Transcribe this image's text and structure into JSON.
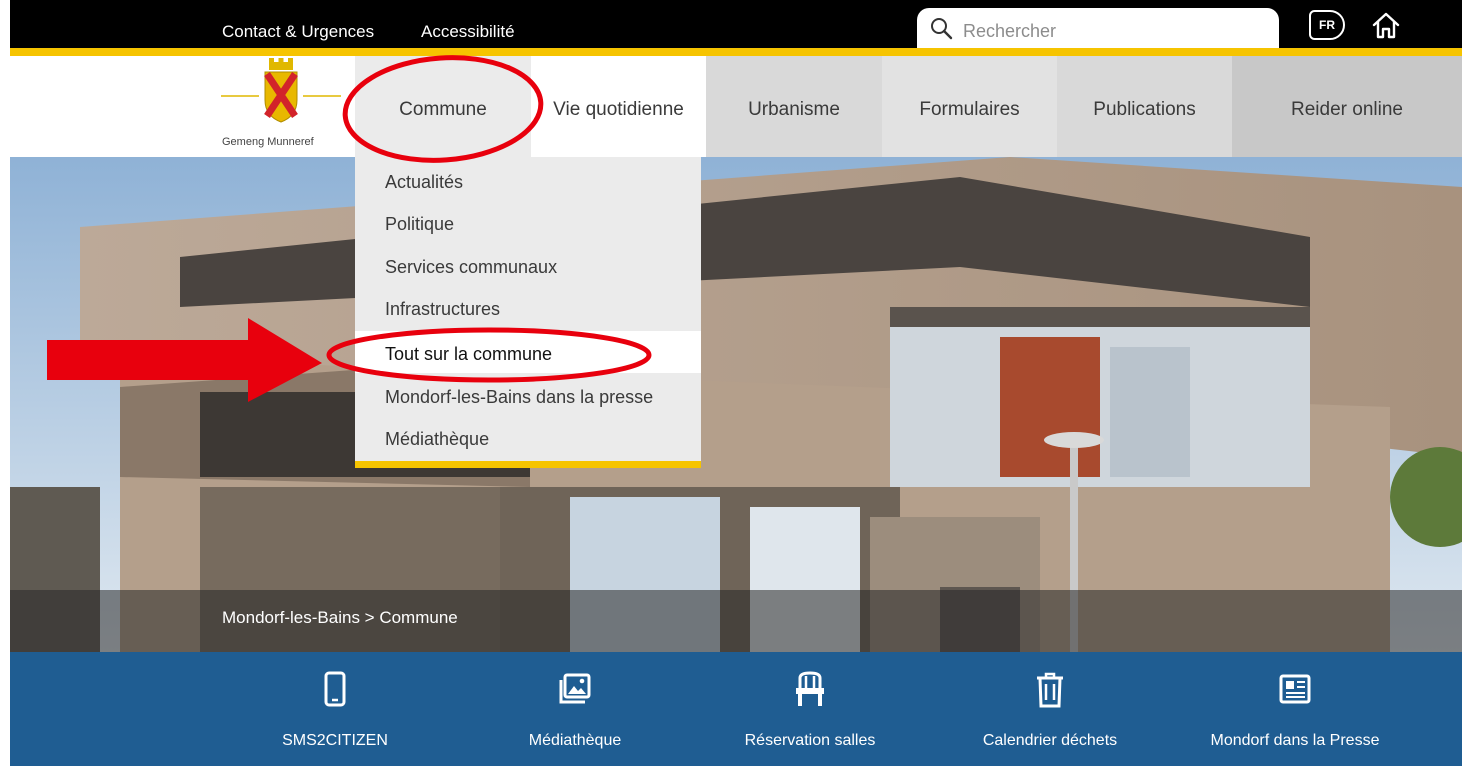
{
  "topbar": {
    "contact_label": "Contact & Urgences",
    "accessibility_label": "Accessibilité",
    "search_placeholder": "Rechercher",
    "language": "FR"
  },
  "logo": {
    "text": "Gemeng Munneref"
  },
  "nav": {
    "items": [
      {
        "label": "Commune"
      },
      {
        "label": "Vie quotidienne"
      },
      {
        "label": "Urbanisme"
      },
      {
        "label": "Formulaires"
      },
      {
        "label": "Publications"
      },
      {
        "label": "Reider online"
      }
    ]
  },
  "dropdown": {
    "items": [
      {
        "label": "Actualités"
      },
      {
        "label": "Politique"
      },
      {
        "label": "Services communaux"
      },
      {
        "label": "Infrastructures"
      },
      {
        "label": "Tout sur la commune"
      },
      {
        "label": "Mondorf-les-Bains dans la presse"
      },
      {
        "label": "Médiathèque"
      }
    ]
  },
  "breadcrumb": {
    "text": "Mondorf-les-Bains > Commune"
  },
  "quicklinks": {
    "items": [
      {
        "label": "SMS2CITIZEN",
        "icon": "phone-icon"
      },
      {
        "label": "Médiathèque",
        "icon": "image-gallery-icon"
      },
      {
        "label": "Réservation salles",
        "icon": "chair-icon"
      },
      {
        "label": "Calendrier déchets",
        "icon": "trash-icon"
      },
      {
        "label": "Mondorf dans la Presse",
        "icon": "newspaper-icon"
      }
    ]
  },
  "colors": {
    "accent_yellow": "#f6c400",
    "quickbar_blue": "#1f5d92",
    "annotation_red": "#e8000d"
  }
}
